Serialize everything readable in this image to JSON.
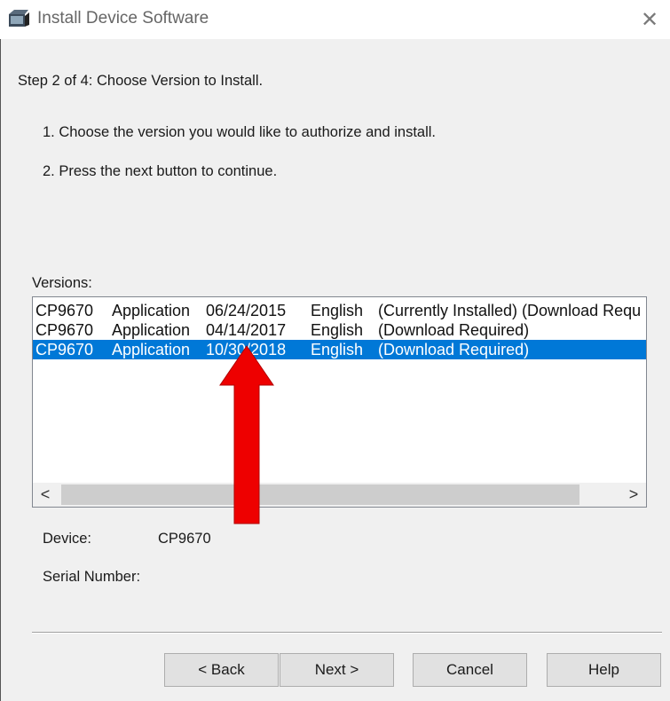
{
  "window": {
    "title": "Install Device Software",
    "close_glyph": "✕",
    "icon": "installer-app-icon"
  },
  "step_title": "Step 2 of 4:  Choose Version to Install.",
  "instructions": [
    "1.  Choose the version you would like to authorize and install.",
    "2.  Press the next button to continue."
  ],
  "versions": {
    "label": "Versions:",
    "rows": [
      {
        "model": "CP9670",
        "type": "Application",
        "date": "06/24/2015",
        "language": "English",
        "status": "(Currently Installed)  (Download Requ",
        "selected": false
      },
      {
        "model": "CP9670",
        "type": "Application",
        "date": "04/14/2017",
        "language": "English",
        "status": "(Download Required)",
        "selected": false
      },
      {
        "model": "CP9670",
        "type": "Application",
        "date": "10/30/2018",
        "language": "English",
        "status": "(Download Required)",
        "selected": true
      }
    ],
    "scroll_left": "<",
    "scroll_right": ">"
  },
  "device": {
    "label": "Device:",
    "value": "CP9670"
  },
  "serial": {
    "label": "Serial Number:",
    "value": ""
  },
  "buttons": {
    "back": "< Back",
    "next": "Next >",
    "cancel": "Cancel",
    "help": "Help"
  },
  "colors": {
    "selection": "#0078d7",
    "annotation_arrow": "#ee0000"
  }
}
